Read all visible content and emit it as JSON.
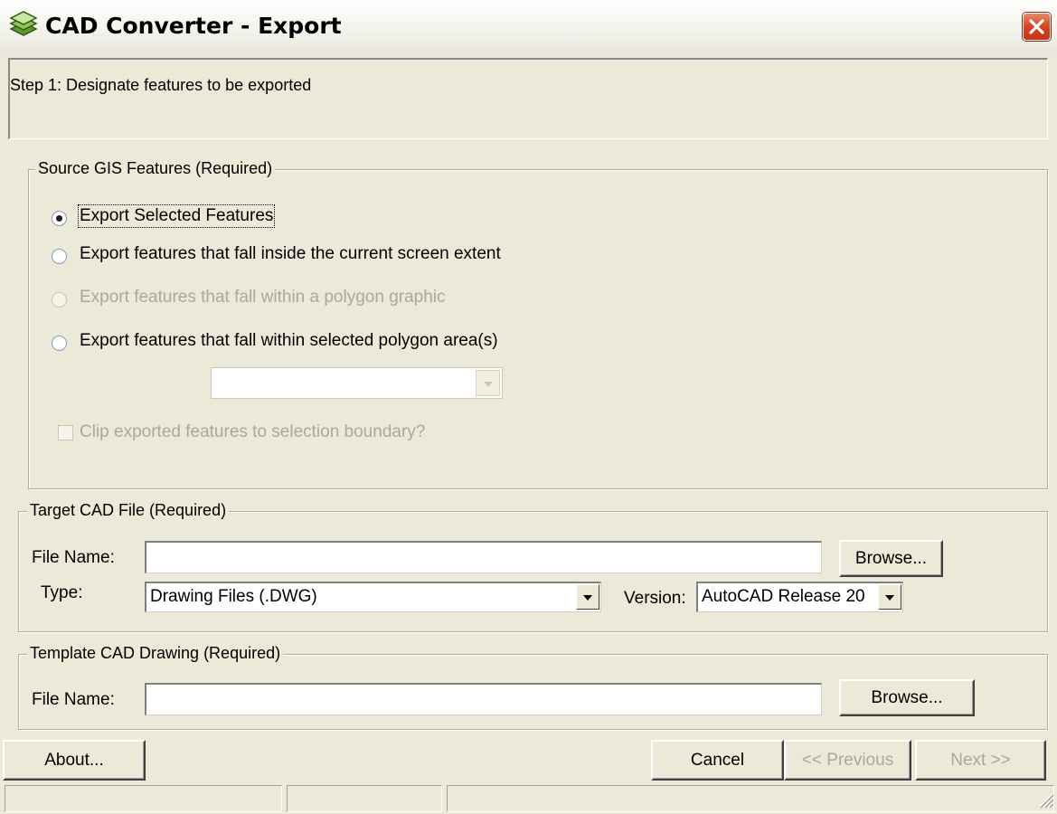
{
  "window": {
    "title": "CAD Converter - Export",
    "icon": "cad-layers-icon",
    "close_icon": "close-icon",
    "accent": "#D6461F"
  },
  "step": {
    "text": "Step 1: Designate features to be exported"
  },
  "source_group": {
    "label": "Source GIS Features (Required)",
    "options": [
      {
        "label": "Export Selected Features",
        "checked": true,
        "enabled": true
      },
      {
        "label": "Export features that fall inside the current screen extent",
        "checked": false,
        "enabled": true
      },
      {
        "label": "Export features that fall within a polygon graphic",
        "checked": false,
        "enabled": false
      },
      {
        "label": "Export features that fall within selected polygon area(s)",
        "checked": false,
        "enabled": true
      }
    ],
    "polygon_layer_value": "",
    "clip_label": "Clip exported features to selection boundary?",
    "clip_checked": false
  },
  "target_group": {
    "label": "Target CAD File (Required)",
    "file_name_label": "File Name:",
    "file_name_value": "",
    "browse_label": "Browse...",
    "type_label": "Type:",
    "type_value": "Drawing Files (.DWG)",
    "version_label": "Version:",
    "version_value": "AutoCAD Release 20"
  },
  "template_group": {
    "label": "Template CAD Drawing (Required)",
    "file_name_label": "File Name:",
    "file_name_value": "",
    "browse_label": "Browse..."
  },
  "buttons": {
    "about": "About...",
    "cancel": "Cancel",
    "previous": "<< Previous",
    "next": "Next >>"
  },
  "statusbar": {
    "cells": [
      "",
      "",
      ""
    ]
  }
}
